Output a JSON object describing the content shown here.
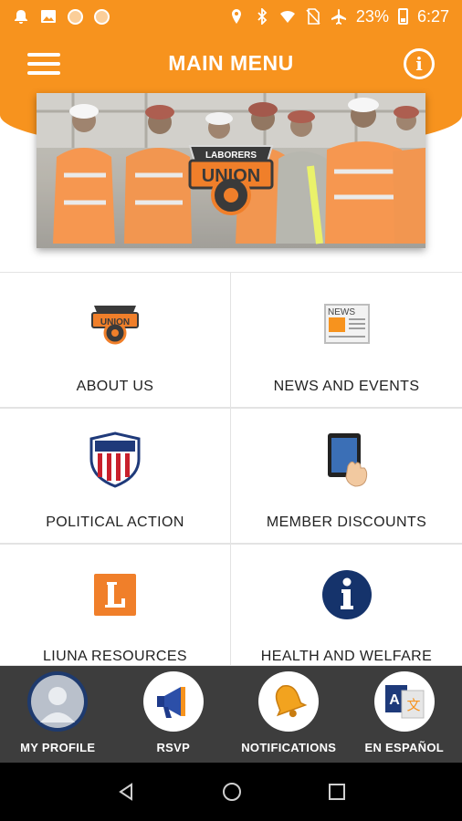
{
  "status_bar": {
    "battery": "23%",
    "time": "6:27"
  },
  "header": {
    "title": "MAIN MENU",
    "banner_logo_text": "LABORERS UNION"
  },
  "menu": {
    "items": [
      {
        "label": "ABOUT US",
        "icon": "union-logo-icon"
      },
      {
        "label": "NEWS AND EVENTS",
        "icon": "newspaper-icon"
      },
      {
        "label": "POLITICAL ACTION",
        "icon": "shield-flag-icon"
      },
      {
        "label": "MEMBER DISCOUNTS",
        "icon": "tablet-touch-icon"
      },
      {
        "label": "LIUNA RESOURCES",
        "icon": "letter-l-icon"
      },
      {
        "label": "HEALTH AND WELFARE",
        "icon": "info-circle-icon"
      }
    ],
    "news_icon_text": "NEWS"
  },
  "bottom_bar": {
    "items": [
      {
        "label": "MY PROFILE",
        "icon": "avatar-icon"
      },
      {
        "label": "RSVP",
        "icon": "megaphone-icon"
      },
      {
        "label": "NOTIFICATIONS",
        "icon": "bell-icon"
      },
      {
        "label": "EN ESPAÑOL",
        "icon": "translate-icon"
      }
    ]
  },
  "colors": {
    "accent": "#f7931e",
    "bottom_bar": "#3d3d3d",
    "nav_bar": "#000000"
  }
}
